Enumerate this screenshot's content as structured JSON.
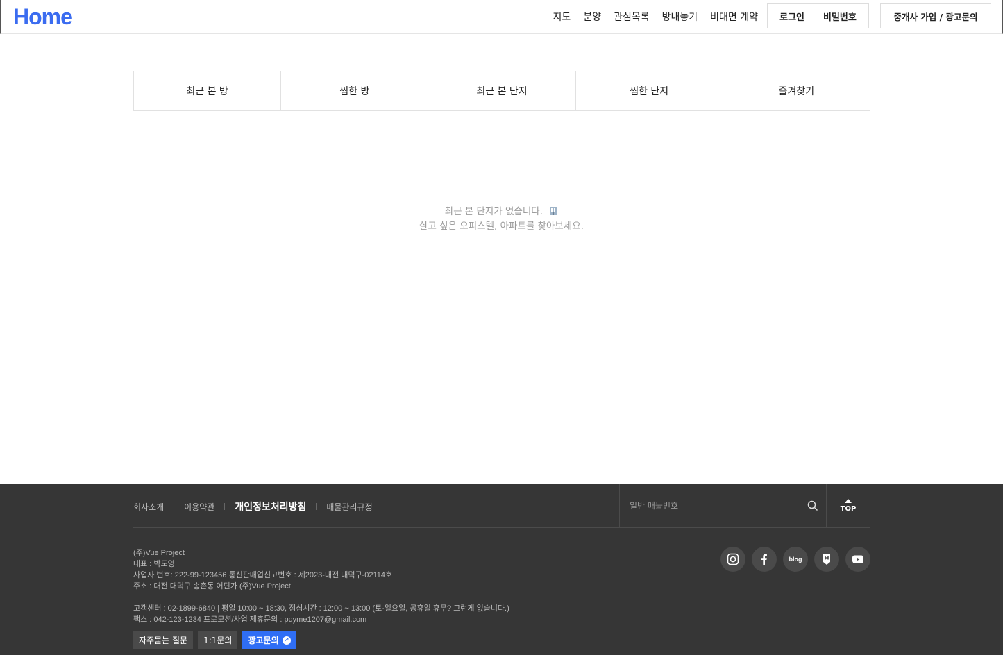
{
  "header": {
    "logo": "Home",
    "nav": [
      "지도",
      "분양",
      "관심목록",
      "방내놓기",
      "비대면 계약"
    ],
    "login_label": "로그인",
    "password_label": "비밀번호",
    "join_label": "중개사 가입 / 광고문의"
  },
  "tabs": [
    "최근 본 방",
    "찜한 방",
    "최근 본 단지",
    "찜한 단지",
    "즐겨찾기"
  ],
  "empty_state": {
    "line1": "최근 본 단지가 없습니다.",
    "line2": "살고 싶은 오피스텔, 아파트를 찾아보세요."
  },
  "footer": {
    "links": [
      "회사소개",
      "이용약관",
      "개인정보처리방침",
      "매물관리규정"
    ],
    "search_placeholder": "일반 매물번호",
    "top_label": "TOP",
    "info": [
      "(주)Vue Project",
      "대표 : 박도영",
      " 사업자 번호: 222-99-123456 통신판매업신고번호 : 제2023-대전 대덕구-02114호",
      "주소 : 대전 대덕구 송촌동 어딘가 (주)Vue Project"
    ],
    "info2": [
      " 고객센터 : 02-1899-6840 | 평일 10:00 ~ 18:30, 점심시간 : 12:00 ~ 13:00 (토·일요일, 공휴일 휴무? 그런게 없습니다.)",
      " 팩스 : 042-123-1234 프로모션/사업 제휴문의 : pdyme1207@gmail.com"
    ],
    "buttons": [
      "자주묻는 질문",
      "1:1문의",
      "광고문의"
    ],
    "socials": [
      "instagram-icon",
      "facebook-icon",
      "blog-icon",
      "post-icon",
      "youtube-icon"
    ],
    "blog_label": "blog"
  },
  "colors": {
    "accent": "#3b6cf0",
    "footer_bg": "#363636",
    "ad_button": "#2f6ef5"
  }
}
